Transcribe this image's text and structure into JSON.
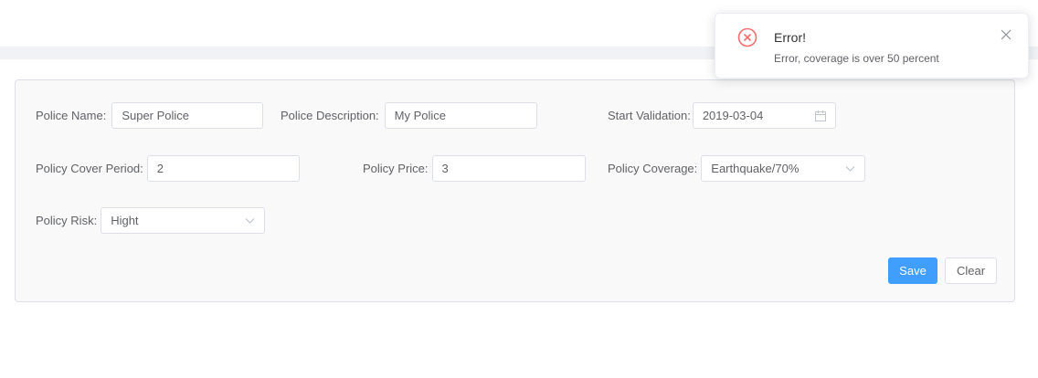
{
  "form": {
    "police_name": {
      "label": "Police Name:",
      "value": "Super Police"
    },
    "police_description": {
      "label": "Police Description:",
      "value": "My Police"
    },
    "start_validation": {
      "label": "Start Validation:",
      "value": "2019-03-04"
    },
    "policy_cover_period": {
      "label": "Policy Cover Period:",
      "value": "2"
    },
    "policy_price": {
      "label": "Policy Price:",
      "value": "3"
    },
    "policy_coverage": {
      "label": "Policy Coverage:",
      "value": "Earthquake/70%"
    },
    "policy_risk": {
      "label": "Policy Risk:",
      "value": "Hight"
    },
    "save_label": "Save",
    "clear_label": "Clear"
  },
  "notification": {
    "title": "Error!",
    "message": "Error, coverage is over 50 percent",
    "icon": "error-circle-icon",
    "color": "#f56c6c"
  },
  "colors": {
    "primary": "#409eff",
    "error": "#f56c6c"
  }
}
